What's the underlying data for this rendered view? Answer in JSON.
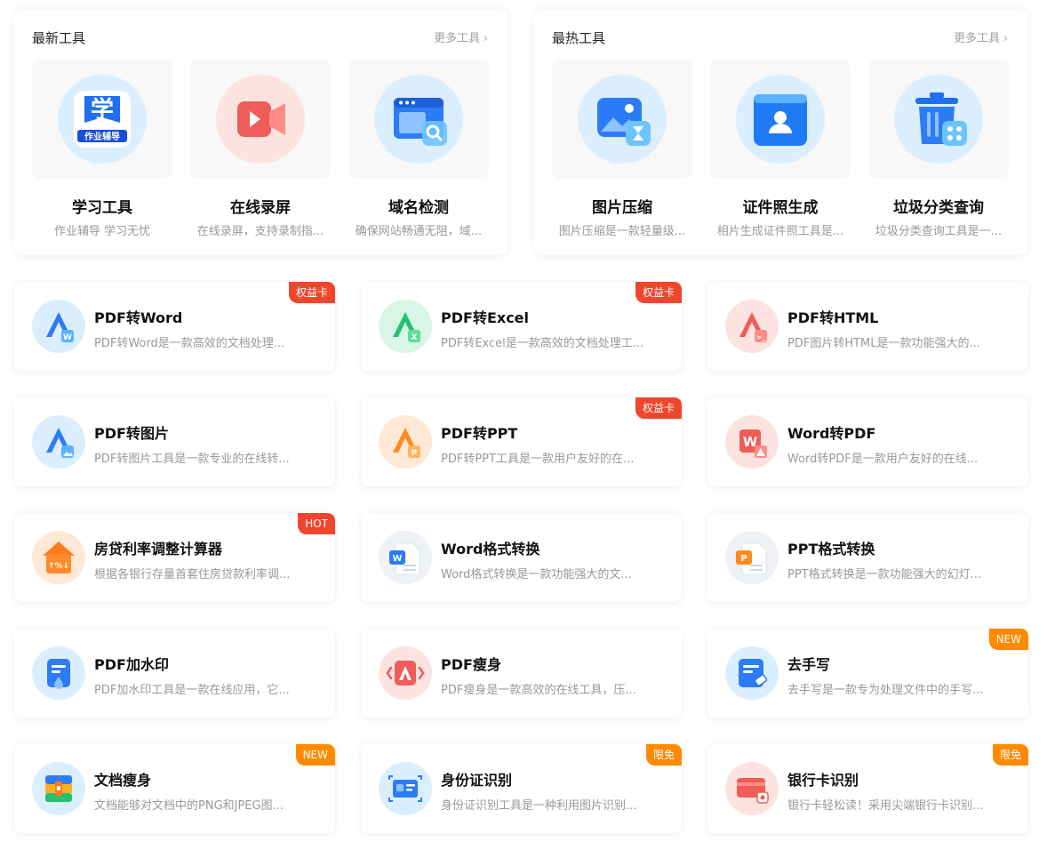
{
  "colors": {
    "accent_blue": "#2b7cf6",
    "badge_red": "#f0462d",
    "badge_orange": "#ff8a00"
  },
  "latest": {
    "title": "最新工具",
    "more": "更多工具",
    "items": [
      {
        "title": "学习工具",
        "desc": "作业辅导 学习无忧",
        "icon": "study-app-icon"
      },
      {
        "title": "在线录屏",
        "desc": "在线录屏，支持录制指...",
        "icon": "screen-record-icon"
      },
      {
        "title": "域名检测",
        "desc": "确保网站畅通无阻，域...",
        "icon": "domain-search-icon"
      }
    ]
  },
  "hottest": {
    "title": "最热工具",
    "more": "更多工具",
    "items": [
      {
        "title": "图片压缩",
        "desc": "图片压缩是一款轻量级...",
        "icon": "image-compress-icon"
      },
      {
        "title": "证件照生成",
        "desc": "相片生成证件照工具是...",
        "icon": "id-photo-icon"
      },
      {
        "title": "垃圾分类查询",
        "desc": "垃圾分类查询工具是一...",
        "icon": "trash-sort-icon"
      }
    ]
  },
  "tools": [
    {
      "title": "PDF转Word",
      "desc": "PDF转Word是一款高效的文档处理...",
      "badge": "权益卡",
      "icon": "pdf-to-word-icon"
    },
    {
      "title": "PDF转Excel",
      "desc": "PDF转Excel是一款高效的文档处理工...",
      "badge": "权益卡",
      "icon": "pdf-to-excel-icon"
    },
    {
      "title": "PDF转HTML",
      "desc": "PDF图片转HTML是一款功能强大的...",
      "badge": "",
      "icon": "pdf-to-html-icon"
    },
    {
      "title": "PDF转图片",
      "desc": "PDF转图片工具是一款专业的在线转...",
      "badge": "",
      "icon": "pdf-to-image-icon"
    },
    {
      "title": "PDF转PPT",
      "desc": "PDF转PPT工具是一款用户友好的在...",
      "badge": "权益卡",
      "icon": "pdf-to-ppt-icon"
    },
    {
      "title": "Word转PDF",
      "desc": "Word转PDF是一款用户友好的在线...",
      "badge": "",
      "icon": "word-to-pdf-icon"
    },
    {
      "title": "房贷利率调整计算器",
      "desc": "根据各银行存量首套住房贷款利率调...",
      "badge": "HOT",
      "icon": "mortgage-rate-icon"
    },
    {
      "title": "Word格式转换",
      "desc": "Word格式转换是一款功能强大的文...",
      "badge": "",
      "icon": "word-format-icon"
    },
    {
      "title": "PPT格式转换",
      "desc": "PPT格式转换是一款功能强大的幻灯...",
      "badge": "",
      "icon": "ppt-format-icon"
    },
    {
      "title": "PDF加水印",
      "desc": "PDF加水印工具是一款在线应用，它...",
      "badge": "",
      "icon": "pdf-watermark-icon"
    },
    {
      "title": "PDF瘦身",
      "desc": "PDF瘦身是一款高效的在线工具，压...",
      "badge": "",
      "icon": "pdf-slim-icon"
    },
    {
      "title": "去手写",
      "desc": "去手写是一款专为处理文件中的手写...",
      "badge": "NEW",
      "icon": "remove-handwriting-icon"
    },
    {
      "title": "文档瘦身",
      "desc": "文档能够对文档中的PNG和JPEG图...",
      "badge": "NEW",
      "icon": "doc-slim-icon"
    },
    {
      "title": "身份证识别",
      "desc": "身份证识别工具是一种利用图片识别...",
      "badge": "限免",
      "icon": "id-card-ocr-icon"
    },
    {
      "title": "银行卡识别",
      "desc": "银行卡轻松读！采用尖端银行卡识别...",
      "badge": "限免",
      "icon": "bank-card-ocr-icon"
    }
  ]
}
